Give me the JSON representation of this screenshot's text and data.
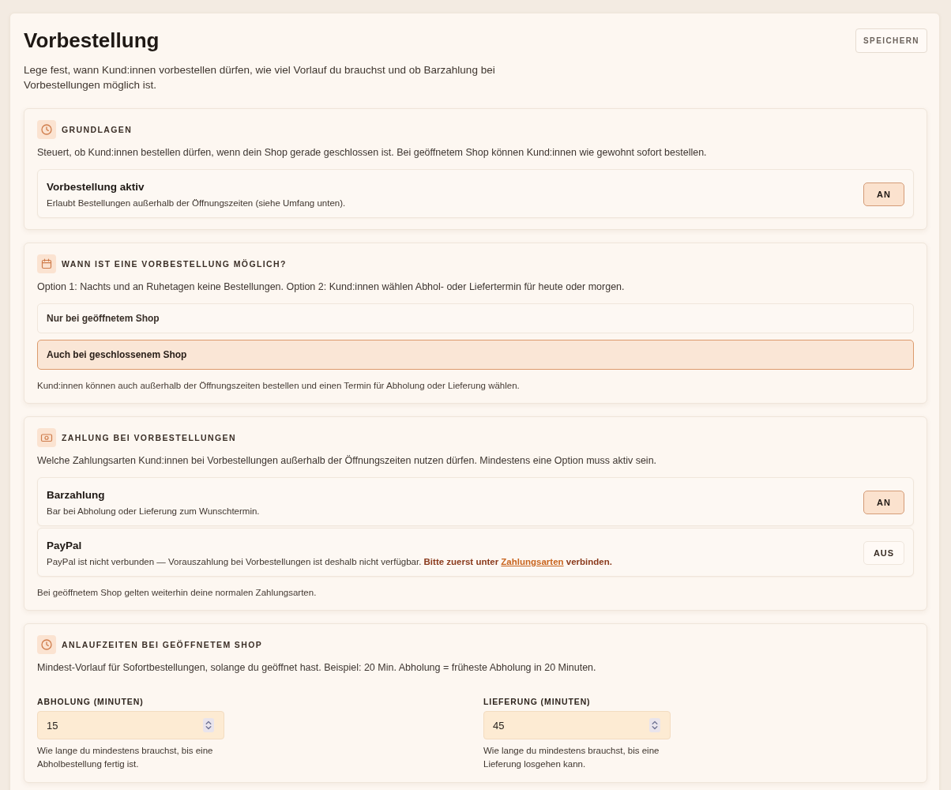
{
  "page": {
    "title": "Vorbestellung",
    "description": "Lege fest, wann Kund:innen vorbestellen dürfen, wie viel Vorlauf du brauchst und ob Barzahlung bei Vorbestellungen möglich ist.",
    "save_button": "SPEICHERN"
  },
  "sections": [
    {
      "kind": "toggles",
      "heading": "GRUNDLAGEN",
      "description": "Steuert, ob Kund:innen bestellen dürfen, wenn dein Shop gerade geschlossen ist. Bei geöffnetem Shop können Kund:innen wie gewohnt sofort bestellen.",
      "toggles": [
        {
          "title": "Vorbestellung aktiv",
          "description": "Erlaubt Bestellungen außerhalb der Öffnungszeiten (siehe Umfang unten).",
          "button": "AN",
          "on": true
        }
      ]
    },
    {
      "kind": "choice",
      "heading": "WANN IST EINE VORBESTELLUNG MÖGLICH?",
      "description": "Option 1: Nachts und an Ruhetagen keine Bestellungen. Option 2: Kund:innen wählen Abhol- oder Liefertermin für heute oder morgen.",
      "options": [
        {
          "label": "Nur bei geöffnetem Shop",
          "selected": false
        },
        {
          "label": "Auch bei geschlossenem Shop",
          "selected": true
        }
      ],
      "note": "Kund:innen können auch außerhalb der Öffnungszeiten bestellen und einen Termin für Abholung oder Lieferung wählen."
    },
    {
      "kind": "toggles",
      "heading": "ZAHLUNG BEI VORBESTELLUNGEN",
      "description": "Welche Zahlungsarten Kund:innen bei Vorbestellungen außerhalb der Öffnungszeiten nutzen dürfen. Mindestens eine Option muss aktiv sein.",
      "toggles": [
        {
          "title": "Barzahlung",
          "description": "Bar bei Abholung oder Lieferung zum Wunschtermin.",
          "button": "AN",
          "on": true
        },
        {
          "title": "PayPal",
          "description": "PayPal ist nicht verbunden — Vorauszahlung bei Vorbestellungen ist deshalb nicht verfügbar.",
          "warning": {
            "before": "Bitte zuerst unter",
            "link": "Zahlungsarten",
            "after": "verbinden."
          },
          "button": "AUS",
          "on": false
        }
      ],
      "note": "Bei geöffnetem Shop gelten weiterhin deine normalen Zahlungsarten."
    },
    {
      "kind": "fields",
      "heading": "ANLAUFZEITEN BEI GEÖFFNETEM SHOP",
      "description": "Mindest-Vorlauf für Sofortbestellungen, solange du geöffnet hast. Beispiel: 20 Min. Abholung = früheste Abholung in 20 Minuten.",
      "fields": [
        {
          "label": "ABHOLUNG (MINUTEN)",
          "value": "15",
          "hint": "Wie lange du mindestens brauchst, bis eine Abholbestellung fertig ist."
        },
        {
          "label": "LIEFERUNG (MINUTEN)",
          "value": "45",
          "hint": "Wie lange du mindestens brauchst, bis eine Lieferung losgehen kann."
        }
      ]
    }
  ]
}
